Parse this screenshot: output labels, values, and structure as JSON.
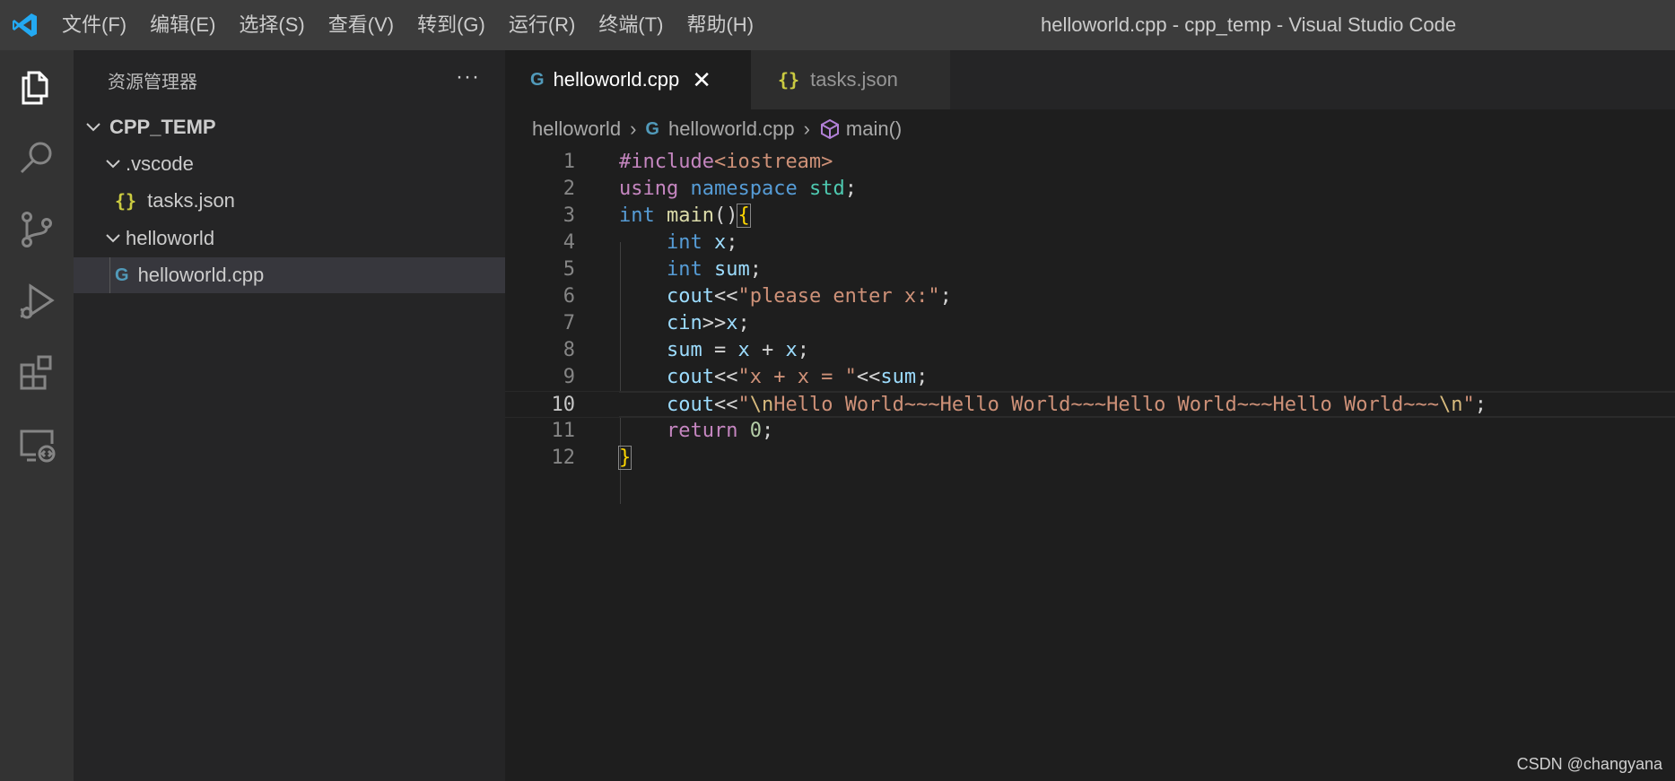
{
  "titlebar": {
    "menus": [
      "文件(F)",
      "编辑(E)",
      "选择(S)",
      "查看(V)",
      "转到(G)",
      "运行(R)",
      "终端(T)",
      "帮助(H)"
    ],
    "window_title": "helloworld.cpp - cpp_temp - Visual Studio Code"
  },
  "activitybar": {
    "items": [
      "explorer-icon",
      "search-icon",
      "source-control-icon",
      "run-debug-icon",
      "extensions-icon",
      "remote-explorer-icon"
    ]
  },
  "sidebar": {
    "title": "资源管理器",
    "more": "···",
    "tree": [
      {
        "label": "CPP_TEMP",
        "kind": "root"
      },
      {
        "label": ".vscode",
        "kind": "folder"
      },
      {
        "label": "tasks.json",
        "kind": "json",
        "icon_text": "{}"
      },
      {
        "label": "helloworld",
        "kind": "folder"
      },
      {
        "label": "helloworld.cpp",
        "kind": "cpp",
        "icon_text": "G",
        "selected": true
      }
    ]
  },
  "tabs": [
    {
      "label": "helloworld.cpp",
      "icon_text": "G",
      "active": true,
      "close": "✕"
    },
    {
      "label": "tasks.json",
      "icon_text": "{}",
      "active": false
    }
  ],
  "breadcrumb": {
    "items": [
      "helloworld",
      "helloworld.cpp",
      "main()"
    ],
    "separator": "›",
    "cpp_icon_text": "G"
  },
  "editor": {
    "current_line": 10,
    "lines": [
      {
        "n": "1",
        "tokens": [
          [
            "pre",
            "#include"
          ],
          [
            "str",
            "<iostream>"
          ]
        ]
      },
      {
        "n": "2",
        "tokens": [
          [
            "ctl",
            "using"
          ],
          [
            "def",
            " "
          ],
          [
            "kw",
            "namespace"
          ],
          [
            "def",
            " "
          ],
          [
            "ns",
            "std"
          ],
          [
            "def",
            ";"
          ]
        ]
      },
      {
        "n": "3",
        "tokens": [
          [
            "kw",
            "int"
          ],
          [
            "def",
            " "
          ],
          [
            "fn",
            "main"
          ],
          [
            "def",
            "()"
          ],
          [
            "brace",
            "{"
          ]
        ]
      },
      {
        "n": "4",
        "tokens": [
          [
            "def",
            "    "
          ],
          [
            "kw",
            "int"
          ],
          [
            "def",
            " "
          ],
          [
            "var",
            "x"
          ],
          [
            "def",
            ";"
          ]
        ]
      },
      {
        "n": "5",
        "tokens": [
          [
            "def",
            "    "
          ],
          [
            "kw",
            "int"
          ],
          [
            "def",
            " "
          ],
          [
            "var",
            "sum"
          ],
          [
            "def",
            ";"
          ]
        ]
      },
      {
        "n": "6",
        "tokens": [
          [
            "def",
            "    "
          ],
          [
            "var",
            "cout"
          ],
          [
            "def",
            "<<"
          ],
          [
            "str",
            "\"please enter x:\""
          ],
          [
            "def",
            ";"
          ]
        ]
      },
      {
        "n": "7",
        "tokens": [
          [
            "def",
            "    "
          ],
          [
            "var",
            "cin"
          ],
          [
            "def",
            ">>"
          ],
          [
            "var",
            "x"
          ],
          [
            "def",
            ";"
          ]
        ]
      },
      {
        "n": "8",
        "tokens": [
          [
            "def",
            "    "
          ],
          [
            "var",
            "sum"
          ],
          [
            "def",
            " = "
          ],
          [
            "var",
            "x"
          ],
          [
            "def",
            " + "
          ],
          [
            "var",
            "x"
          ],
          [
            "def",
            ";"
          ]
        ]
      },
      {
        "n": "9",
        "tokens": [
          [
            "def",
            "    "
          ],
          [
            "var",
            "cout"
          ],
          [
            "def",
            "<<"
          ],
          [
            "str",
            "\"x + x = \""
          ],
          [
            "def",
            "<<"
          ],
          [
            "var",
            "sum"
          ],
          [
            "def",
            ";"
          ]
        ]
      },
      {
        "n": "10",
        "tokens": [
          [
            "def",
            "    "
          ],
          [
            "var",
            "cout"
          ],
          [
            "def",
            "<<"
          ],
          [
            "str",
            "\""
          ],
          [
            "esc",
            "\\n"
          ],
          [
            "str",
            "Hello World~~~Hello World~~~Hello World~~~Hello World~~~"
          ],
          [
            "esc",
            "\\n"
          ],
          [
            "str",
            "\""
          ],
          [
            "def",
            ";"
          ]
        ]
      },
      {
        "n": "11",
        "tokens": [
          [
            "def",
            "    "
          ],
          [
            "ctl",
            "return"
          ],
          [
            "def",
            " "
          ],
          [
            "num",
            "0"
          ],
          [
            "def",
            ";"
          ]
        ]
      },
      {
        "n": "12",
        "tokens": [
          [
            "brace",
            "}"
          ]
        ]
      }
    ]
  },
  "watermark": "CSDN @changyana",
  "colors": {
    "titlebar": "#3c3c3c",
    "activitybar": "#333333",
    "sidebar": "#252526",
    "editor": "#1e1e1e",
    "vscode_blue": "#23a9f2"
  }
}
